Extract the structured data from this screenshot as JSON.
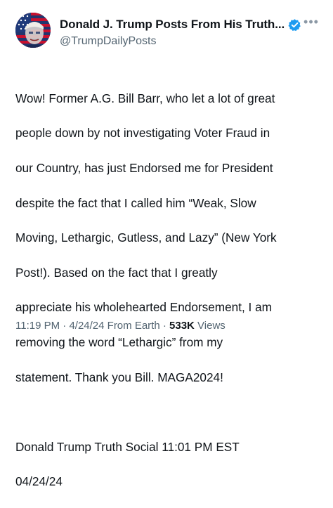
{
  "post": {
    "display_name": "Donald J. Trump Posts From His Truth...",
    "handle": "@TrumpDailyPosts",
    "verified_icon": "verified-badge-icon",
    "more_icon": "more-options-icon",
    "text_lines": [
      "Wow! Former A.G. Bill Barr, who let a lot of great",
      "people down by not investigating Voter Fraud in",
      "our Country, has just Endorsed me for President",
      "despite the fact that I called him “Weak, Slow",
      "Moving, Lethargic, Gutless, and Lazy” (New York",
      "Post!). Based on the fact that I greatly",
      "appreciate his wholehearted Endorsement, I am",
      "removing the word “Lethargic” from my",
      "statement. Thank you Bill. MAGA2024!",
      "",
      "Donald Trump Truth Social 11:01 PM EST",
      "04/24/24"
    ],
    "time": "11:19 PM",
    "separator": "·",
    "date": "4/24/24 From Earth",
    "views_count": "533K",
    "views_label": "Views"
  },
  "colors": {
    "text_primary": "#0f1419",
    "text_secondary": "#536471",
    "verified_blue": "#1d9bf0"
  }
}
